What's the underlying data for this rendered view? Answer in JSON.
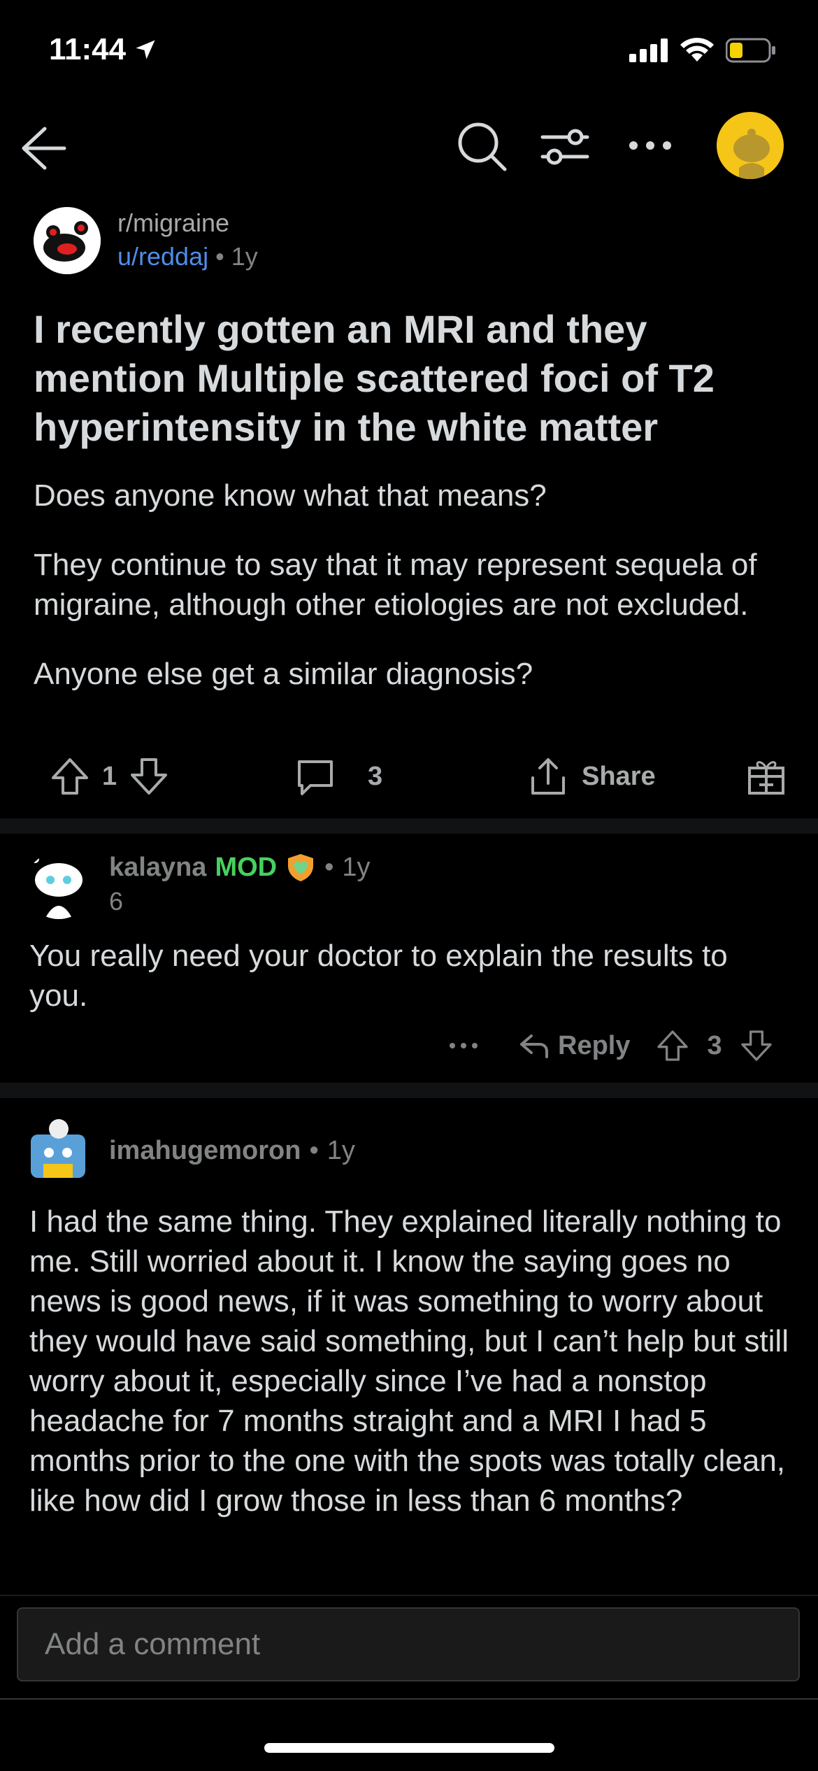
{
  "status_bar": {
    "time": "11:44",
    "location_icon": "location-arrow-icon",
    "signal_icon": "cellular-signal-icon",
    "wifi_icon": "wifi-icon",
    "battery_icon": "battery-low-icon",
    "battery_color": "#f5d100"
  },
  "nav": {
    "back_icon": "back-arrow-icon",
    "search_icon": "search-icon",
    "filter_icon": "sort-filter-icon",
    "more_icon": "more-horizontal-icon",
    "avatar_color": "#f5c518"
  },
  "post": {
    "subreddit": "r/migraine",
    "author": "u/reddaj",
    "separator": "•",
    "age": "1y",
    "title": "I recently gotten an MRI and they mention Multiple scattered foci of T2 hyperintensity in the white matter",
    "body": [
      "Does anyone know what that means?",
      "They continue to say that it may represent sequela of migraine, although other etiologies are not excluded.",
      "Anyone else get a similar diagnosis?"
    ],
    "votes": "1",
    "comments": "3",
    "share_label": "Share"
  },
  "comments": [
    {
      "author": "kalayna",
      "badge": "MOD",
      "separator": "•",
      "age": "1y",
      "flair": "6",
      "body": "You really need your doctor to explain the results to you.",
      "reply_label": "Reply",
      "votes": "3"
    },
    {
      "author": "imahugemoron",
      "separator": "•",
      "age": "1y",
      "body": "I had the same thing. They explained literally nothing to me. Still worried about it. I know the saying goes no news is good news, if it was something to worry about they would have said something, but I can’t help but still worry about it, especially since I’ve had a nonstop headache for 7 months straight and a MRI I had 5 months prior to the one with the spots was totally clean, like how did I grow those in less than 6 months?"
    }
  ],
  "composer": {
    "placeholder": "Add a comment"
  },
  "colors": {
    "background": "#000000",
    "text": "#d7dadc",
    "muted": "#818384",
    "link": "#4f8ee8",
    "mod": "#46d160"
  }
}
